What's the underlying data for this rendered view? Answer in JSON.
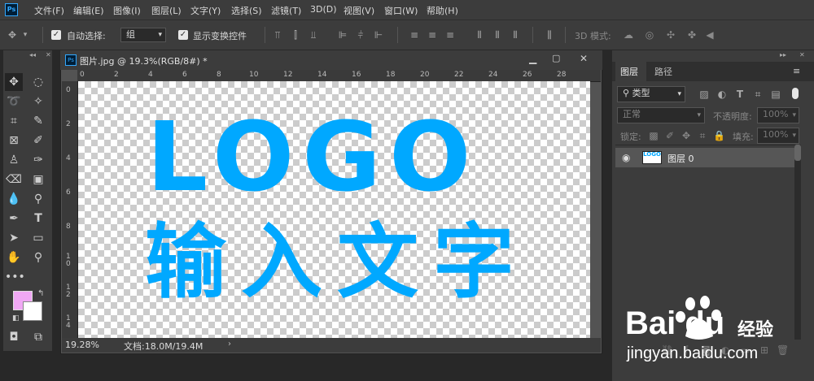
{
  "app": {
    "logo": "Ps"
  },
  "menu": [
    "文件(F)",
    "编辑(E)",
    "图像(I)",
    "图层(L)",
    "文字(Y)",
    "选择(S)",
    "滤镜(T)",
    "3D(D)",
    "视图(V)",
    "窗口(W)",
    "帮助(H)"
  ],
  "options": {
    "auto_select_label": "自动选择:",
    "auto_select_value": "组",
    "show_transform_label": "显示变换控件",
    "mode_3d_label": "3D 模式:"
  },
  "document": {
    "tab_title": "图片.jpg @ 19.3%(RGB/8#) *",
    "ruler_top": [
      "0",
      "2",
      "4",
      "6",
      "8",
      "10",
      "12",
      "14",
      "16",
      "18",
      "20",
      "22",
      "24",
      "26",
      "28"
    ],
    "ruler_left": [
      "0",
      "2",
      "4",
      "6",
      "8",
      "1\n0",
      "1\n2",
      "1\n4",
      "1\n6"
    ],
    "canvas_line1": "LOGO",
    "canvas_line2": "输入文字",
    "zoom": "19.28%",
    "doc_info": "文档:18.0M/19.4M",
    "text_color": "#00a8ff"
  },
  "layers_panel": {
    "tabs": [
      "图层",
      "路径"
    ],
    "filter_kind": "类型",
    "blend_mode": "正常",
    "opacity_label": "不透明度:",
    "opacity_value": "100%",
    "lock_label": "锁定:",
    "fill_label": "填充:",
    "fill_value": "100%",
    "layers": [
      {
        "name": "图层 0",
        "visible": true
      }
    ]
  },
  "colors": {
    "foreground": "#f0a8f4",
    "background": "#ffffff"
  },
  "watermark": {
    "brand": "Bai du",
    "cn": "经验",
    "url": "jingyan.baidu.com"
  }
}
